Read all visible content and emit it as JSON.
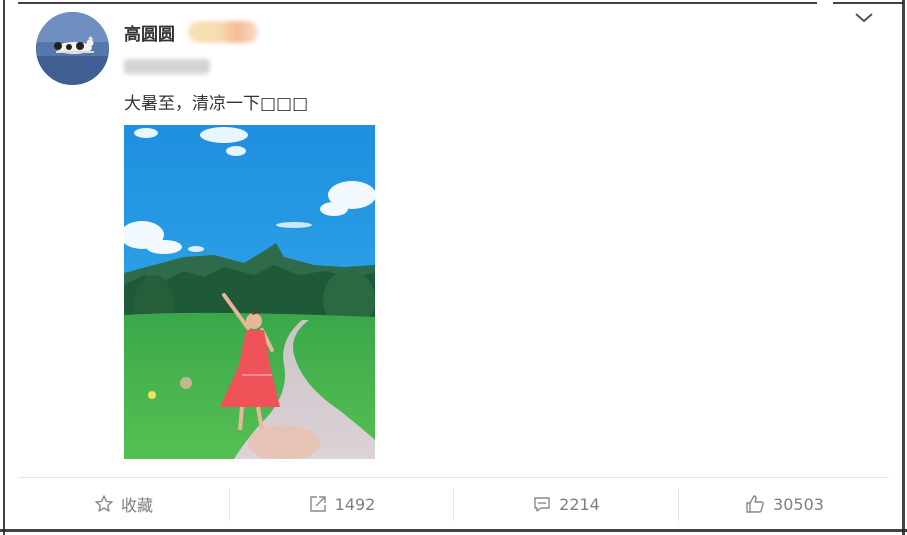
{
  "post": {
    "username": "高圆圆",
    "text": "大暑至，清凉一下□□□"
  },
  "actions": {
    "favorite": {
      "icon": "star-icon",
      "label": "收藏"
    },
    "repost": {
      "icon": "share-icon",
      "count": "1492"
    },
    "comment": {
      "icon": "comment-icon",
      "count": "2214"
    },
    "like": {
      "icon": "thumbs-up-icon",
      "count": "30503"
    }
  },
  "colors": {
    "text": "#333333",
    "muted": "#7f7f7f",
    "divider": "#e6e6e6"
  }
}
